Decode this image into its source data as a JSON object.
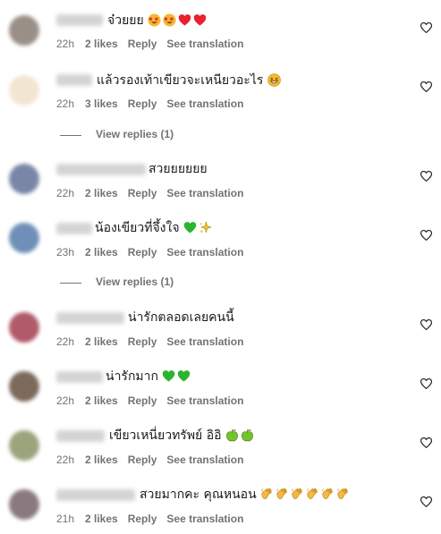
{
  "comments": [
    {
      "text": "จ๋วยยย",
      "emoji_icons": [
        "star-struck-emoji-icon",
        "star-struck-emoji-icon",
        "red-heart-emoji-icon",
        "red-heart-emoji-icon"
      ],
      "time": "22h",
      "likes": "2 likes",
      "reply": "Reply",
      "translate": "See translation",
      "avatar_color": "#9a8f86"
    },
    {
      "text": "แล้วรองเท้าเขียวจะเหนียวอะไร",
      "emoji_icons": [
        "grinning-squint-emoji-icon"
      ],
      "time": "22h",
      "likes": "3 likes",
      "reply": "Reply",
      "translate": "See translation",
      "avatar_color": "#f2e6d2"
    },
    {
      "text": "สวยยยยยย",
      "emoji_icons": [],
      "time": "22h",
      "likes": "2 likes",
      "reply": "Reply",
      "translate": "See translation",
      "avatar_color": "#7a86a8"
    },
    {
      "text": "น้องเขียวที่จึ้งใจ",
      "emoji_icons": [
        "green-heart-emoji-icon",
        "sparkles-emoji-icon"
      ],
      "time": "23h",
      "likes": "2 likes",
      "reply": "Reply",
      "translate": "See translation",
      "avatar_color": "#6f8fb8"
    },
    {
      "text": "น่ารักตลอดเลยคนนี้",
      "emoji_icons": [],
      "time": "22h",
      "likes": "2 likes",
      "reply": "Reply",
      "translate": "See translation",
      "avatar_color": "#b05a6a"
    },
    {
      "text": "น่ารักมาก",
      "emoji_icons": [
        "green-heart-emoji-icon",
        "green-heart-emoji-icon"
      ],
      "time": "22h",
      "likes": "2 likes",
      "reply": "Reply",
      "translate": "See translation",
      "avatar_color": "#7c6a5a"
    },
    {
      "text": "เขียวเหนี่ยวทรัพย์ อิอิ",
      "emoji_icons": [
        "green-apple-emoji-icon",
        "green-apple-emoji-icon"
      ],
      "time": "22h",
      "likes": "2 likes",
      "reply": "Reply",
      "translate": "See translation",
      "avatar_color": "#9aa57e"
    },
    {
      "text": "สวยมากคะ คุณหนอน",
      "emoji_icons": [
        "clapping-hands-emoji-icon",
        "clapping-hands-emoji-icon",
        "clapping-hands-emoji-icon",
        "clapping-hands-emoji-icon",
        "clapping-hands-emoji-icon",
        "clapping-hands-emoji-icon"
      ],
      "time": "21h",
      "likes": "2 likes",
      "reply": "Reply",
      "translate": "See translation",
      "avatar_color": "#8a7a80"
    }
  ],
  "view_replies": [
    {
      "label": "View replies (1)"
    },
    {
      "label": "View replies (1)"
    }
  ],
  "colors": {
    "meta_text": "#737373",
    "heart_outline": "#262626"
  }
}
